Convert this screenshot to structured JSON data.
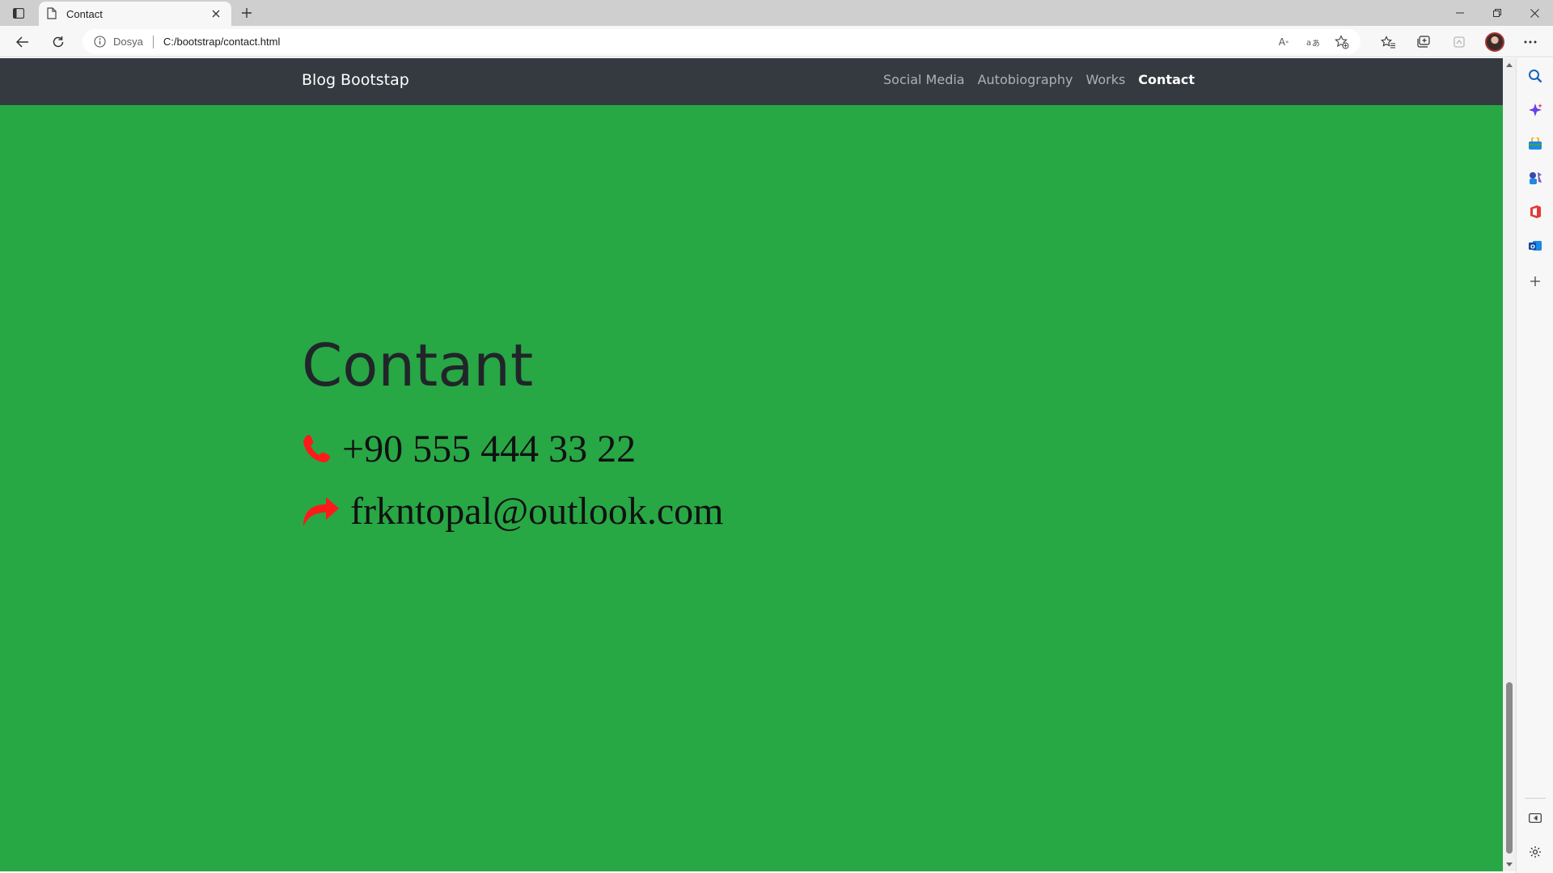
{
  "browser": {
    "tab": {
      "title": "Contact"
    },
    "address": {
      "site_label": "Dosya",
      "url": "C:/bootstrap/contact.html"
    },
    "url_actions": [
      "read-aloud",
      "translate",
      "add-favorite"
    ],
    "toolbar": [
      "favorites",
      "collections",
      "extensions",
      "profile",
      "more"
    ]
  },
  "page": {
    "navbar": {
      "brand": "Blog Bootstap",
      "links": [
        {
          "label": "Social Media",
          "active": false
        },
        {
          "label": "Autobiography",
          "active": false
        },
        {
          "label": "Works",
          "active": false
        },
        {
          "label": "Contact",
          "active": true
        }
      ]
    },
    "heading": "Contant",
    "phone": {
      "icon": "phone-icon",
      "text": "+90 555 444 33 22"
    },
    "email": {
      "icon": "share-arrow-icon",
      "text": "frkntopal@outlook.com"
    }
  },
  "colors": {
    "page_background": "#28a745",
    "navbar_background": "#343a40",
    "icon_color": "#ff1a1a",
    "heading_color": "#212529"
  }
}
